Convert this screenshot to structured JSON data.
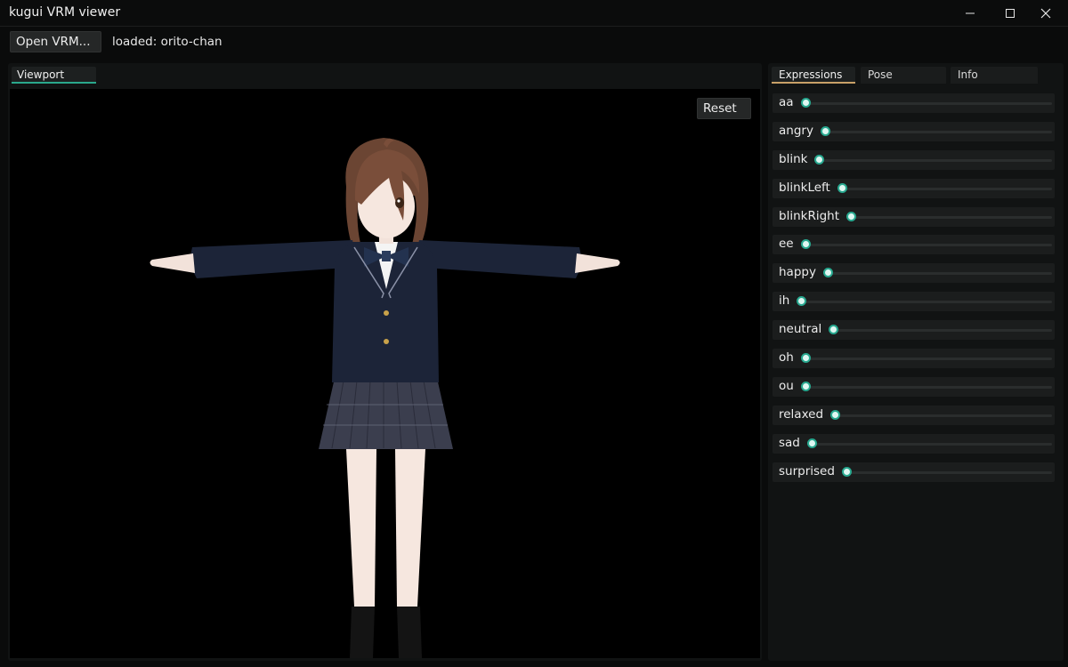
{
  "window": {
    "title": "kugui VRM viewer",
    "controls": [
      "minimize-icon",
      "maximize-icon",
      "close-icon"
    ]
  },
  "toolbar": {
    "open_button": "Open VRM...",
    "status": "loaded: orito-chan"
  },
  "viewport_panel": {
    "tab": "Viewport",
    "reset_button": "Reset"
  },
  "side_panel": {
    "tabs": [
      {
        "label": "Expressions",
        "active": true
      },
      {
        "label": "Pose",
        "active": false
      },
      {
        "label": "Info",
        "active": false
      }
    ],
    "expressions": [
      {
        "name": "aa",
        "value": 0
      },
      {
        "name": "angry",
        "value": 0
      },
      {
        "name": "blink",
        "value": 0
      },
      {
        "name": "blinkLeft",
        "value": 0
      },
      {
        "name": "blinkRight",
        "value": 0
      },
      {
        "name": "ee",
        "value": 0
      },
      {
        "name": "happy",
        "value": 0
      },
      {
        "name": "ih",
        "value": 0
      },
      {
        "name": "neutral",
        "value": 0
      },
      {
        "name": "oh",
        "value": 0
      },
      {
        "name": "ou",
        "value": 0
      },
      {
        "name": "relaxed",
        "value": 0
      },
      {
        "name": "sad",
        "value": 0
      },
      {
        "name": "surprised",
        "value": 0
      }
    ]
  },
  "colors": {
    "accent_teal": "#27a88f",
    "accent_gold": "#c8a068",
    "background": "#0a0b0b",
    "viewport_bg": "#000000"
  }
}
